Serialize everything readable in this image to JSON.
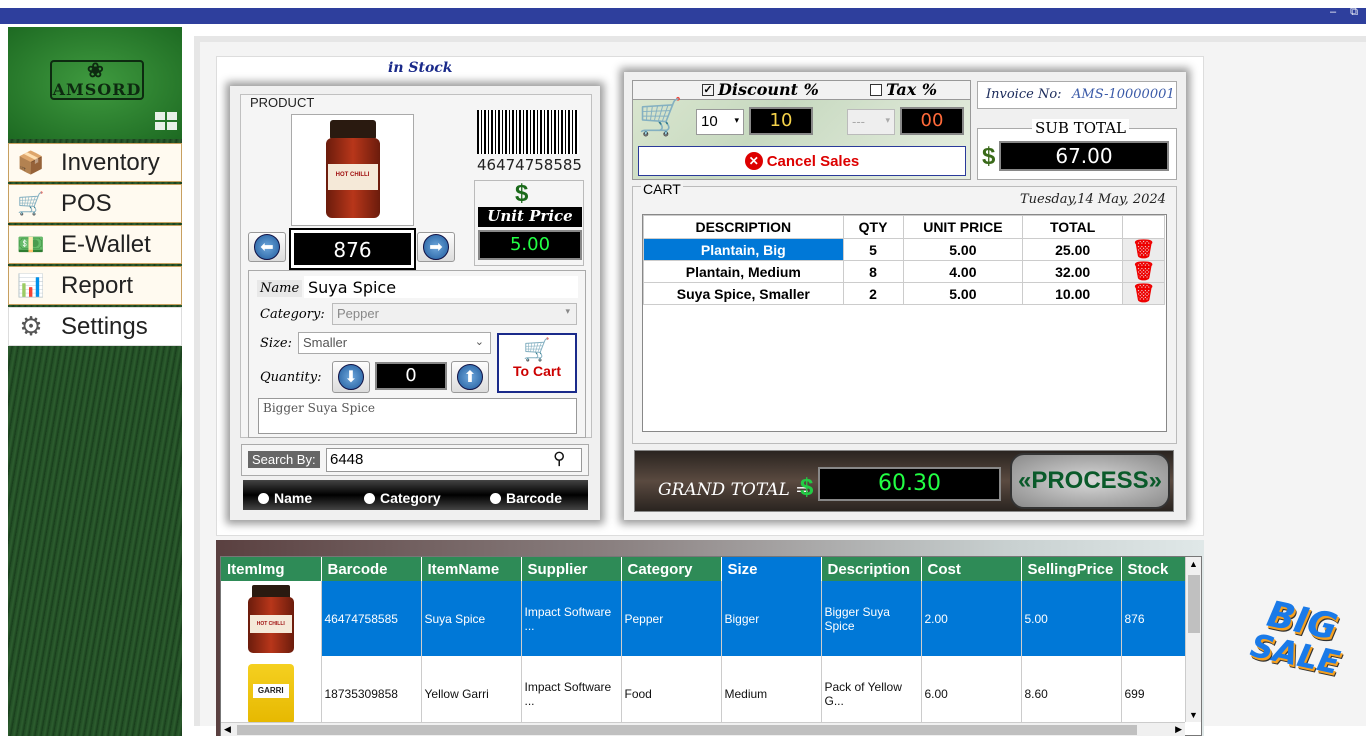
{
  "app": {
    "brand": "AMSORD"
  },
  "window": {
    "minimize": "–",
    "restore": "⧉"
  },
  "nav": [
    {
      "label": "Inventory",
      "icon": "inventory-icon"
    },
    {
      "label": "POS",
      "icon": "cart-icon"
    },
    {
      "label": "E-Wallet",
      "icon": "wallet-icon"
    },
    {
      "label": "Report",
      "icon": "report-icon"
    },
    {
      "label": "Settings",
      "icon": "settings-icon"
    }
  ],
  "stock_status": "in Stock",
  "product": {
    "section_label": "PRODUCT",
    "barcode": "46474758585",
    "currency_symbol": "$",
    "unit_price_label": "Unit Price",
    "unit_price": "5.00",
    "stock_count": "876",
    "name_label": "Name",
    "name": "Suya Spice",
    "category_label": "Category:",
    "category": "Pepper",
    "size_label": "Size:",
    "size": "Smaller",
    "quantity_label": "Quantity:",
    "quantity": "0",
    "to_cart_label": "To Cart",
    "description": "Bigger Suya Spice",
    "product_image_text": "HOT CHILLI"
  },
  "search": {
    "label": "Search By:",
    "value": "6448",
    "options": [
      {
        "label": "Name"
      },
      {
        "label": "Category"
      },
      {
        "label": "Barcode"
      }
    ]
  },
  "pos": {
    "discount_label": "Discount %",
    "discount_checked": true,
    "tax_label": "Tax %",
    "tax_checked": false,
    "discount_select": "10",
    "discount_value": "10",
    "tax_select": "---",
    "tax_value": "00",
    "cancel_label": "Cancel Sales",
    "invoice_label": "Invoice No:",
    "invoice_no": "AMS-10000001",
    "subtotal_label": "SUB TOTAL",
    "currency_symbol": "$",
    "subtotal": "67.00",
    "cart_label": "CART",
    "date": "Tuesday,14 May, 2024",
    "cart_headers": [
      "DESCRIPTION",
      "QTY",
      "UNIT PRICE",
      "TOTAL"
    ],
    "cart_rows": [
      {
        "description": "Plantain, Big",
        "qty": "5",
        "unit_price": "5.00",
        "total": "25.00"
      },
      {
        "description": "Plantain, Medium",
        "qty": "8",
        "unit_price": "4.00",
        "total": "32.00"
      },
      {
        "description": "Suya Spice, Smaller",
        "qty": "2",
        "unit_price": "5.00",
        "total": "10.00"
      }
    ],
    "grand_total_label": "GRAND TOTAL =",
    "grand_total": "60.30",
    "process_label": "«PROCESS»"
  },
  "inventory_grid": {
    "headers": [
      "ItemImg",
      "Barcode",
      "ItemName",
      "Supplier",
      "Category",
      "Size",
      "Description",
      "Cost",
      "SellingPrice",
      "Stock"
    ],
    "rows": [
      {
        "img_text": "HOT CHILLI",
        "barcode": "46474758585",
        "name": "Suya Spice",
        "supplier": "Impact Software ...",
        "category": "Pepper",
        "size": "Bigger",
        "description": "Bigger Suya Spice",
        "cost": "2.00",
        "selling": "5.00",
        "stock": "876"
      },
      {
        "img_text": "GARRI",
        "barcode": "18735309858",
        "name": "Yellow Garri",
        "supplier": "Impact Software ...",
        "category": "Food",
        "size": "Medium",
        "description": "Pack of Yellow G...",
        "cost": "6.00",
        "selling": "8.60",
        "stock": "699"
      }
    ]
  },
  "promo": {
    "line1": "BIG",
    "line2": "SALE"
  },
  "colors": {
    "accent": "#0078d7",
    "header_green": "#2e8b57",
    "brand_green": "#1d6a22",
    "titlebar": "#2e3f9d"
  }
}
